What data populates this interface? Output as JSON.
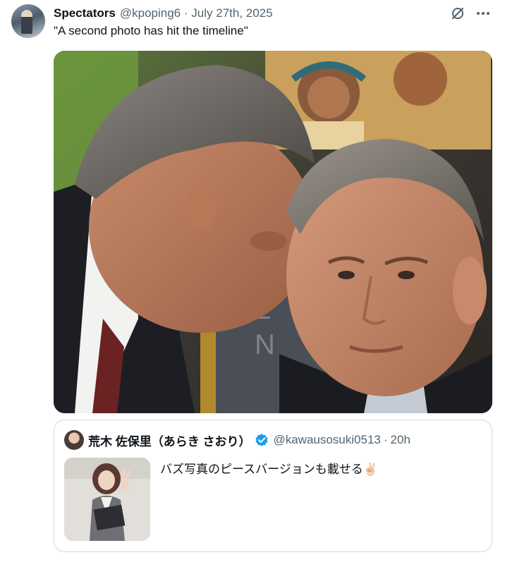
{
  "tweet": {
    "author_name": "Spectators",
    "author_handle": "@kpoping6",
    "date": "July 27th, 2025",
    "separator": "·",
    "text": "\"A second photo has hit the timeline\""
  },
  "quote": {
    "author_name": "荒木 佐保里（あらき さおり）",
    "author_handle": "@kawausosuki0513",
    "separator": "·",
    "time": "20h",
    "text": "バズ写真のピースバージョンも載せる✌🏻"
  },
  "icons": {
    "grok": "grok-icon",
    "more": "more-icon",
    "verified": "verified-badge-icon"
  },
  "colors": {
    "text": "#0f1419",
    "secondary": "#536471",
    "border": "#cfd9de",
    "verified": "#1d9bf0"
  }
}
